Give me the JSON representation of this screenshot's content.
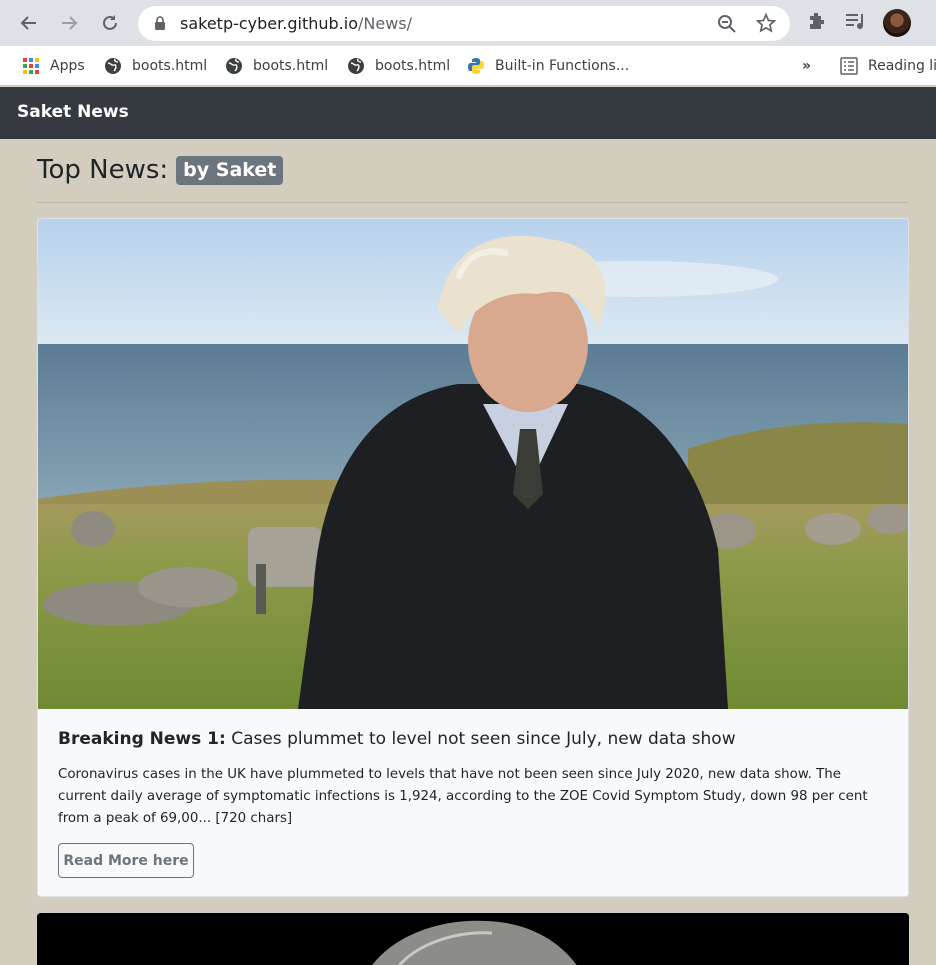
{
  "browser": {
    "url_host": "saketp-cyber.github.io",
    "url_path": "/News/",
    "bookmarks": [
      {
        "label": "Apps",
        "icon": "apps-grid-icon"
      },
      {
        "label": "boots.html",
        "icon": "globe-icon"
      },
      {
        "label": "boots.html",
        "icon": "globe-icon"
      },
      {
        "label": "boots.html",
        "icon": "globe-icon"
      },
      {
        "label": "Built-in Functions...",
        "icon": "python-icon"
      }
    ],
    "overflow_label": "»",
    "reading_list_label": "Reading li"
  },
  "navbar": {
    "brand": "Saket News"
  },
  "page": {
    "heading": "Top News:",
    "badge": "by Saket"
  },
  "cards": [
    {
      "title_prefix": "Breaking News 1:",
      "title": "Cases plummet to level not seen since July, new data show",
      "text": "Coronavirus cases in the UK have plummeted to levels that have not been seen since July 2020, new data show. The current daily average of symptomatic infections is 1,924, according to the ZOE Covid Symptom Study, down 98 per cent from a peak of 69,00... [720 chars]",
      "button": "Read More here"
    }
  ]
}
